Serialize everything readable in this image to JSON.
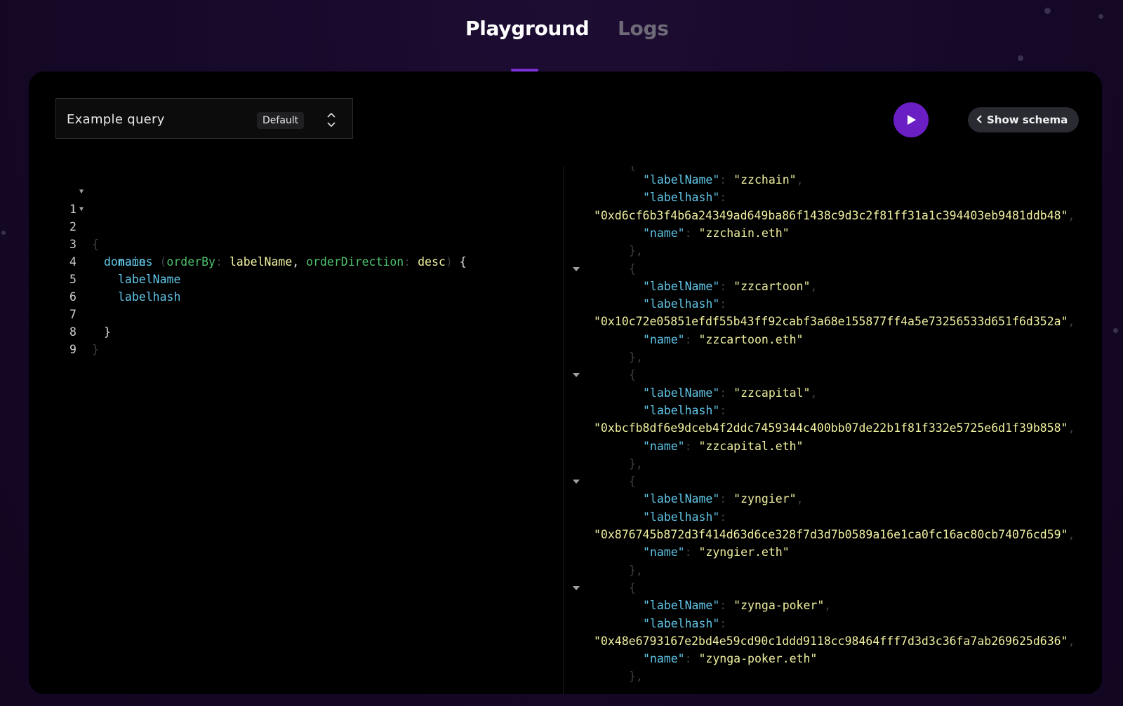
{
  "tabs": [
    {
      "label": "Playground",
      "active": true
    },
    {
      "label": "Logs",
      "active": false
    }
  ],
  "query": {
    "label": "Example query",
    "badge": "Default"
  },
  "toolbar": {
    "schema_label": "Show schema"
  },
  "editor": {
    "line_numbers": [
      "1",
      "2",
      "3",
      "4",
      "5",
      "6",
      "7",
      "8",
      "9"
    ],
    "lines": [
      {
        "punc_open": "{"
      },
      {
        "field": "domains",
        "p1": " (",
        "arg1": "orderBy",
        "c1": ": ",
        "val1": "labelName",
        "comma": ", ",
        "arg2": "orderDirection",
        "c2": ": ",
        "val2": "desc",
        "p2": ") ",
        "brace": "{"
      },
      {
        "field": "name"
      },
      {
        "field": "labelName"
      },
      {
        "field": "labelhash"
      },
      {},
      {
        "brace": "}"
      },
      {
        "punc_close": "}"
      },
      {}
    ]
  },
  "results": {
    "top_punc": "{",
    "records": [
      {
        "labelName": "zzchain",
        "labelhash": "0xd6cf6b3f4b6a24349ad649ba86f1438c9d3c2f81ff31a1c394403eb9481ddb48",
        "name": "zzchain.eth"
      },
      {
        "labelName": "zzcartoon",
        "labelhash": "0x10c72e05851efdf55b43ff92cabf3a68e155877ff4a5e73256533d651f6d352a",
        "name": "zzcartoon.eth"
      },
      {
        "labelName": "zzcapital",
        "labelhash": "0xbcfb8df6e9dceb4f2ddc7459344c400bb07de22b1f81f332e5725e6d1f39b858",
        "name": "zzcapital.eth"
      },
      {
        "labelName": "zyngier",
        "labelhash": "0x876745b872d3f414d63d6ce328f7d3d7b0589a16e1ca0fc16ac80cb74076cd59",
        "name": "zyngier.eth"
      },
      {
        "labelName": "zynga-poker",
        "labelhash": "0x48e6793167e2bd4e59cd90c1ddd9118cc98464fff7d3d3c36fa7ab269625d636",
        "name": "zynga-poker.eth"
      }
    ],
    "keys": {
      "labelName": "\"labelName\"",
      "labelhash": "\"labelhash\"",
      "name": "\"name\""
    },
    "close_obj": "},",
    "open_obj": "{"
  },
  "colors": {
    "accent": "#7b2fd6",
    "run_button": "#6a1fc4",
    "json_key": "#60c5e7",
    "json_string": "#f0f0a0",
    "gql_arg": "#4ec26d"
  },
  "icons": [
    "updown-chevron-icon",
    "play-icon",
    "chevron-left-icon",
    "fold-arrow-icon"
  ]
}
